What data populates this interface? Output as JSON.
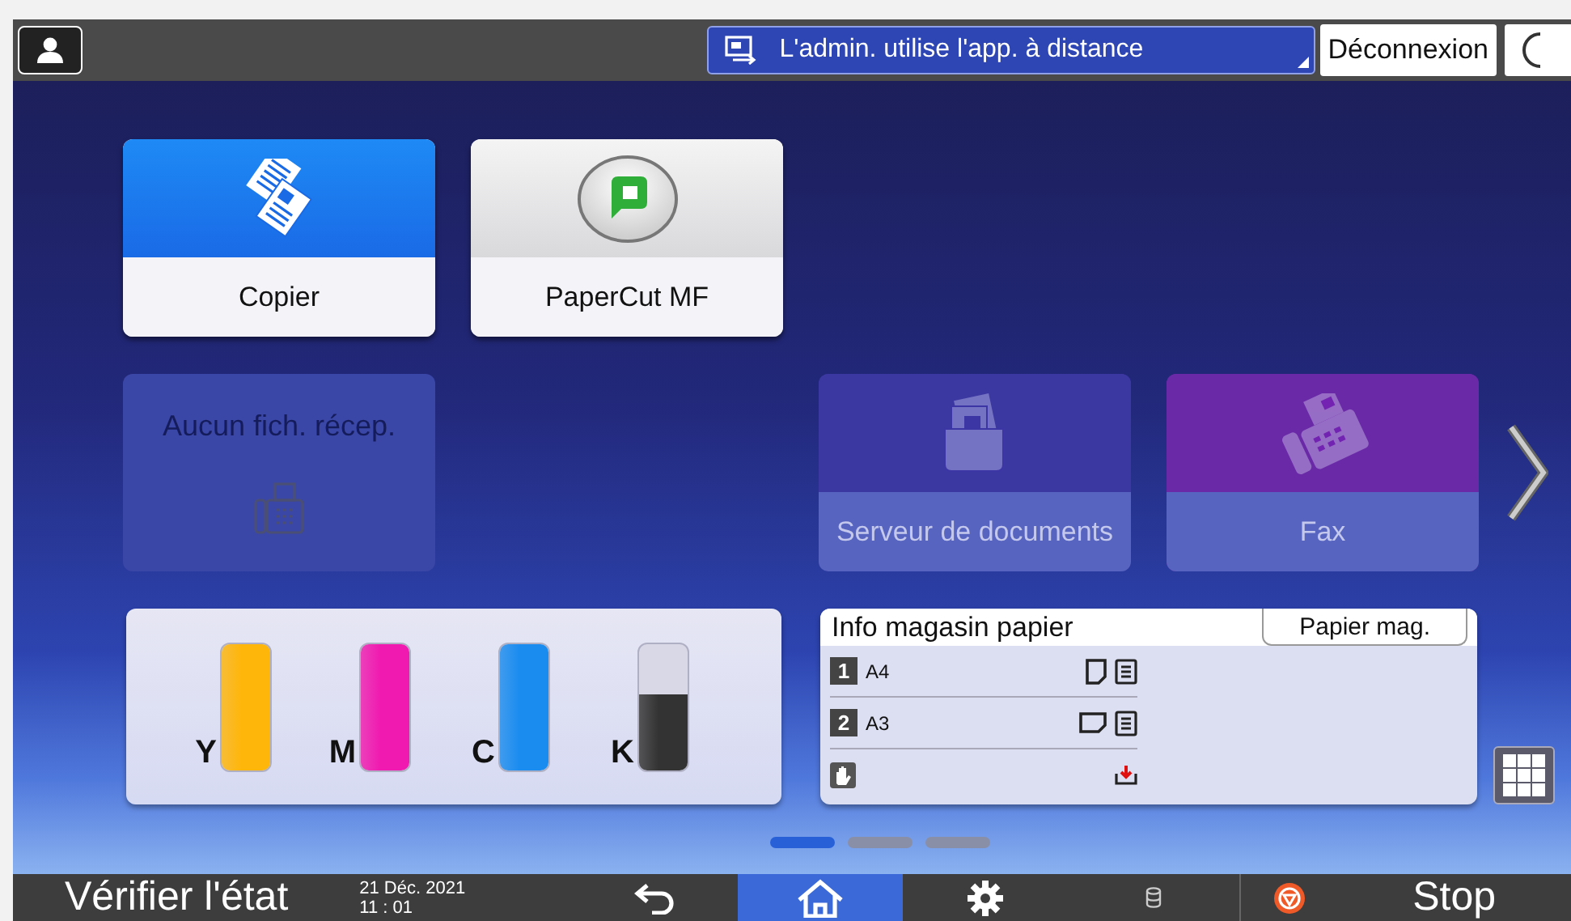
{
  "top_bar": {
    "remote_status": "L'admin. utilise l'app. à distance",
    "logout": "Déconnexion"
  },
  "tiles": [
    {
      "kind": "app",
      "label": "Copier",
      "color": "#1a6ae6",
      "disabled": false
    },
    {
      "kind": "app",
      "label": "PaperCut MF",
      "color": "#d9d9dc",
      "disabled": false
    },
    {
      "kind": "status",
      "label": "Aucun fich. récep.",
      "color": "#3b47a6",
      "disabled": true
    },
    {
      "kind": "app",
      "label": "Serveur de documents",
      "color": "#3c38a2",
      "disabled": true
    },
    {
      "kind": "app",
      "label": "Fax",
      "color": "#6a2aa8",
      "disabled": true
    }
  ],
  "toner": [
    {
      "label": "Y",
      "color": "#ffb60a",
      "level": 1
    },
    {
      "label": "M",
      "color": "#f01ab0",
      "level": 1
    },
    {
      "label": "C",
      "color": "#1a8cf0",
      "level": 1
    },
    {
      "label": "K",
      "color": "#333333",
      "level": 0.6
    }
  ],
  "paper_trays": {
    "title": "Info magasin papier",
    "button": "Papier mag.",
    "trays": [
      {
        "number": "1",
        "size": "A4",
        "kind": "portrait"
      },
      {
        "number": "2",
        "size": "A3",
        "kind": "landscape"
      }
    ]
  },
  "pages": [
    {
      "selected": true
    },
    {
      "selected": false
    },
    {
      "selected": false
    }
  ],
  "bottom_bar": {
    "status_button": "Vérifier l'état",
    "date": "21 Déc. 2021",
    "time": "11 : 01",
    "nav": [
      {
        "kind": "back",
        "selected": false
      },
      {
        "kind": "home",
        "selected": true
      },
      {
        "kind": "settings",
        "selected": false
      }
    ],
    "stop": "Stop"
  }
}
